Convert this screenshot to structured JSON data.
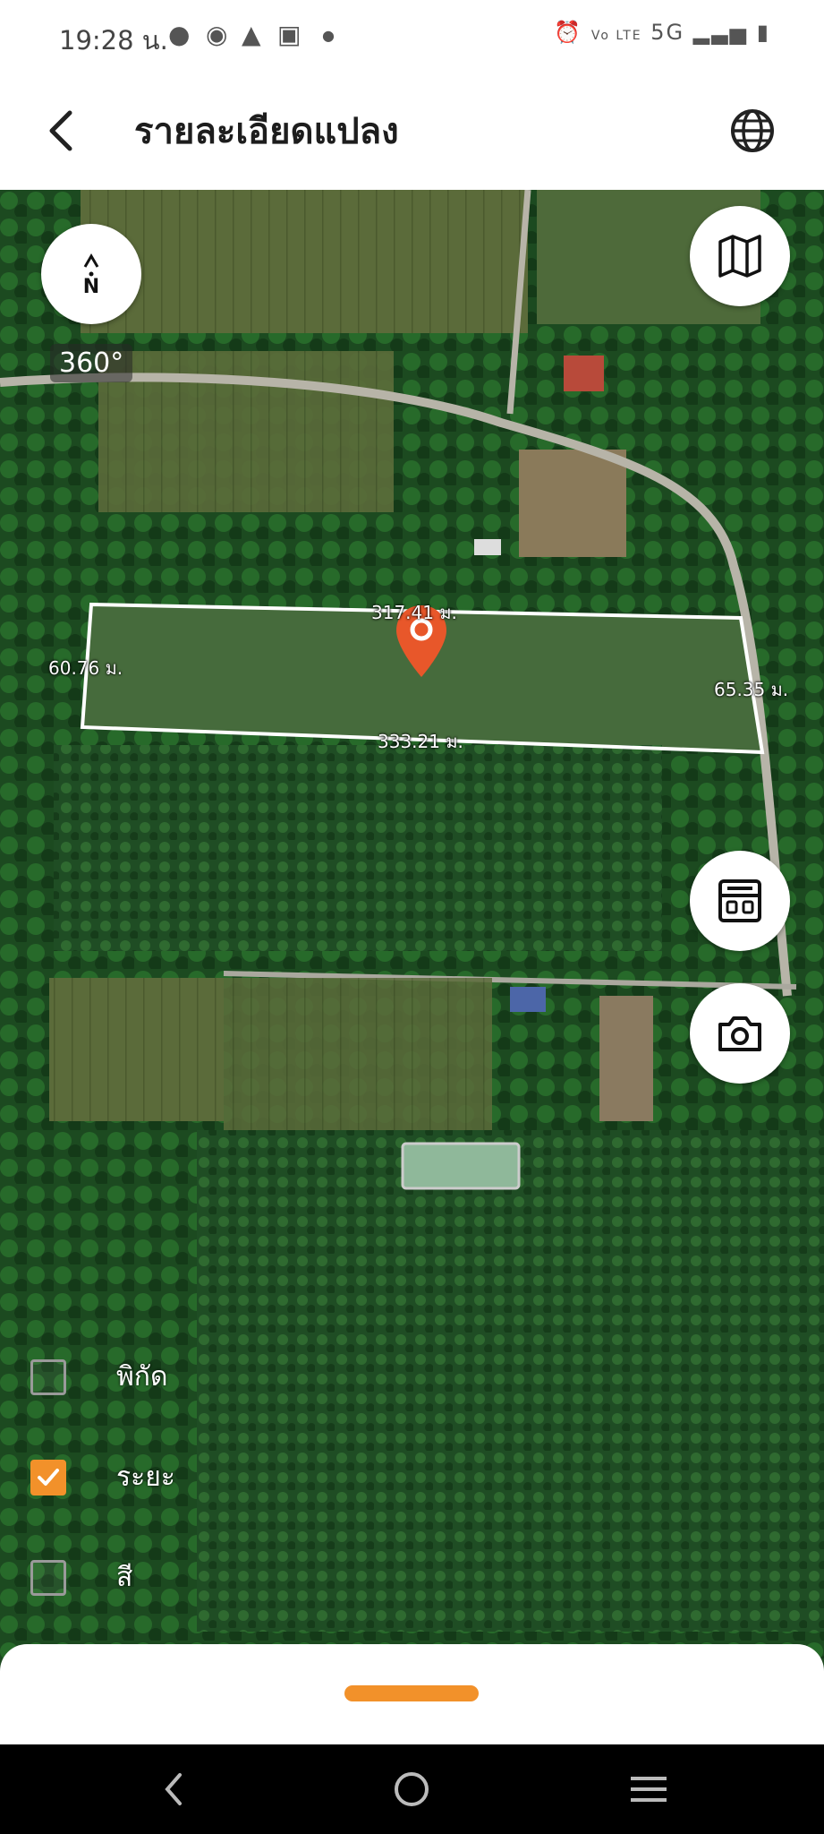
{
  "status_bar": {
    "time": "19:28 น.",
    "right_text": "5G"
  },
  "header": {
    "title": "รายละเอียดแปลง"
  },
  "map": {
    "compass_label": "N",
    "heading_badge": "360°",
    "plot_dimensions": {
      "top": "317.41 ม.",
      "bottom": "333.21 ม.",
      "left": "60.76 ม.",
      "right": "65.35 ม."
    },
    "layer_options": [
      {
        "label": "พิกัด",
        "checked": false
      },
      {
        "label": "ระยะ",
        "checked": true
      },
      {
        "label": "สี",
        "checked": false
      }
    ]
  },
  "colors": {
    "accent": "#f2912a",
    "marker": "#e8572a",
    "plot_outline": "#ffffff"
  },
  "icons": [
    "back-arrow-icon",
    "globe-icon",
    "compass-icon",
    "map-icon",
    "calculator-icon",
    "camera-icon",
    "location-pin-icon",
    "nav-back-icon",
    "nav-home-icon",
    "nav-recents-icon"
  ]
}
